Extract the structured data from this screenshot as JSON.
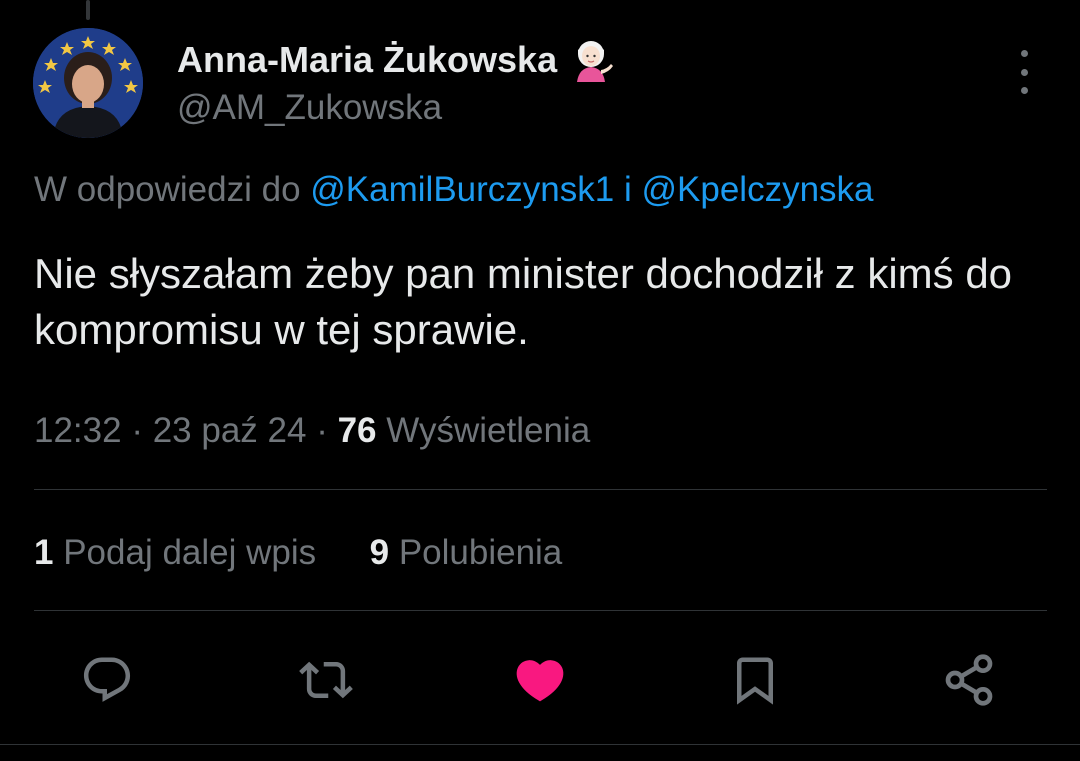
{
  "author": {
    "name": "Anna-Maria Żukowska",
    "handle": "@AM_Zukowska",
    "badge_emoji_icon": "woman-tipping-hand-icon"
  },
  "reply_context": {
    "prefix": "W odpowiedzi do",
    "mention_1": "@KamilBurczynsk1",
    "conjunction": "i",
    "mention_2": "@Kpelczynska"
  },
  "tweet": {
    "text": "Nie słyszałam żeby pan minister dochodził z kimś do kompromisu w tej sprawie."
  },
  "meta": {
    "time": "12:32",
    "date": "23 paź 24",
    "separator": "·",
    "views_count": "76",
    "views_label": "Wyświetlenia"
  },
  "stats": {
    "reposts_count": "1",
    "reposts_label": "Podaj dalej wpis",
    "likes_count": "9",
    "likes_label": "Polubienia"
  },
  "actions": [
    {
      "icon": "reply-icon"
    },
    {
      "icon": "repost-icon"
    },
    {
      "icon": "like-heart-icon",
      "active": true
    },
    {
      "icon": "bookmark-icon"
    },
    {
      "icon": "share-icon"
    }
  ],
  "colors": {
    "background": "#000000",
    "text_primary": "#e7e9ea",
    "text_secondary": "#71767b",
    "link": "#1d9bf0",
    "like_active": "#f91880",
    "divider": "#2f3336"
  }
}
